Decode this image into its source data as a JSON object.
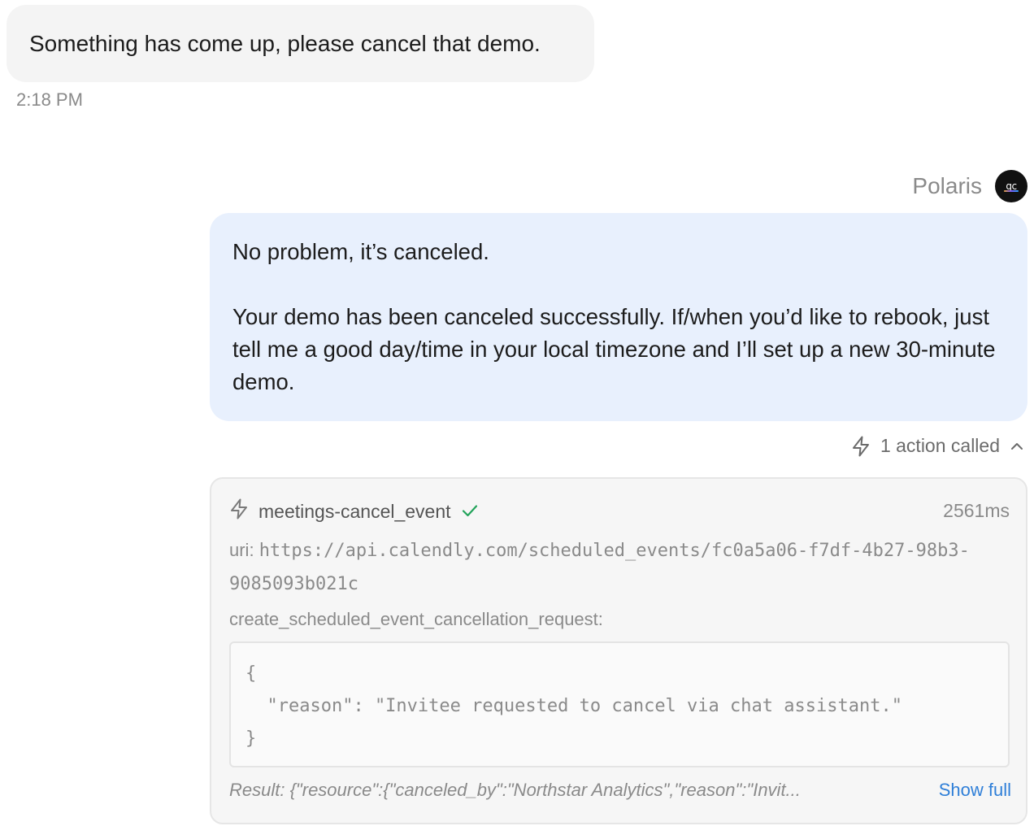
{
  "user_message": {
    "text": "Something has come up, please cancel that demo.",
    "time": "2:18 PM"
  },
  "assistant": {
    "name": "Polaris",
    "avatar_text": "qc",
    "paragraphs": [
      "No problem, it’s canceled.",
      "Your demo has been canceled successfully. If/when you’d like to rebook, just tell me a good day/time in your local timezone and I’ll set up a new 30-minute demo."
    ]
  },
  "actions": {
    "summary": "1 action called",
    "item": {
      "name": "meetings-cancel_event",
      "status": "success",
      "duration": "2561ms",
      "uri_label": "uri:",
      "uri_value": "https://api.calendly.com/scheduled_events/fc0a5a06-f7df-4b27-98b3-9085093b021c",
      "param_label": "create_scheduled_event_cancellation_request:",
      "param_json": "{\n  \"reason\": \"Invitee requested to cancel via chat assistant.\"\n}",
      "result_text": "Result: {\"resource\":{\"canceled_by\":\"Northstar Analytics\",\"reason\":\"Invit...",
      "show_full_label": "Show full"
    }
  },
  "colors": {
    "user_bubble_bg": "#f4f4f4",
    "assistant_bubble_bg": "#e8f0fd",
    "success_check": "#22a35a",
    "link": "#2f7fd8"
  },
  "icons": {
    "action_summary": "lightning-icon",
    "collapse": "chevron-up-icon",
    "action_item": "lightning-icon",
    "status": "check-icon"
  }
}
